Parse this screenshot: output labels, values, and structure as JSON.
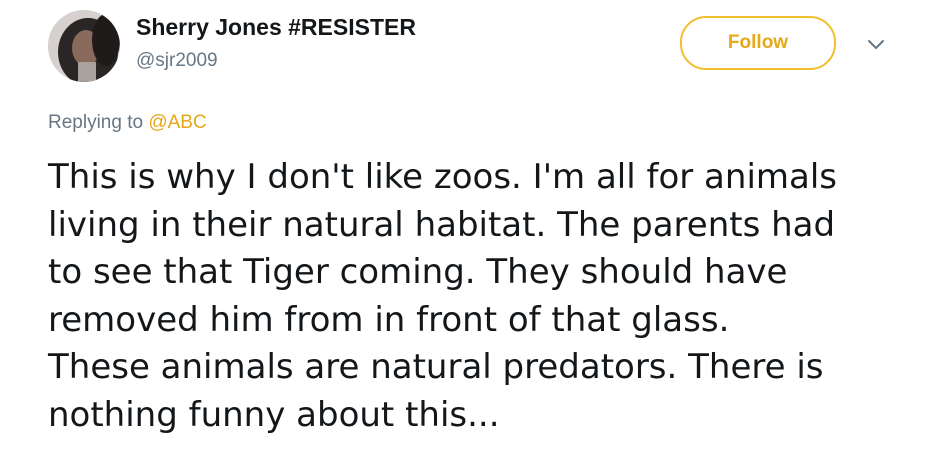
{
  "author": {
    "display_name": "Sherry Jones #RESISTER",
    "screen_name": "@sjr2009"
  },
  "follow_button": {
    "label": "Follow"
  },
  "reply": {
    "prefix": "Replying to",
    "mention": "@ABC"
  },
  "tweet": {
    "lines": [
      "This is why I don't like zoos. I'm all for animals",
      "living in their natural habitat. The parents had",
      "to see that Tiger coming. They should have",
      "removed him from in front of that glass.",
      "These animals are natural predators. There is",
      "nothing funny about this..."
    ]
  },
  "icons": {
    "menu": "chevron-down-icon"
  },
  "colors": {
    "accent": "#e6a817",
    "follow_border": "#f3be2e",
    "secondary_text": "#657786",
    "primary_text": "#14171a"
  }
}
